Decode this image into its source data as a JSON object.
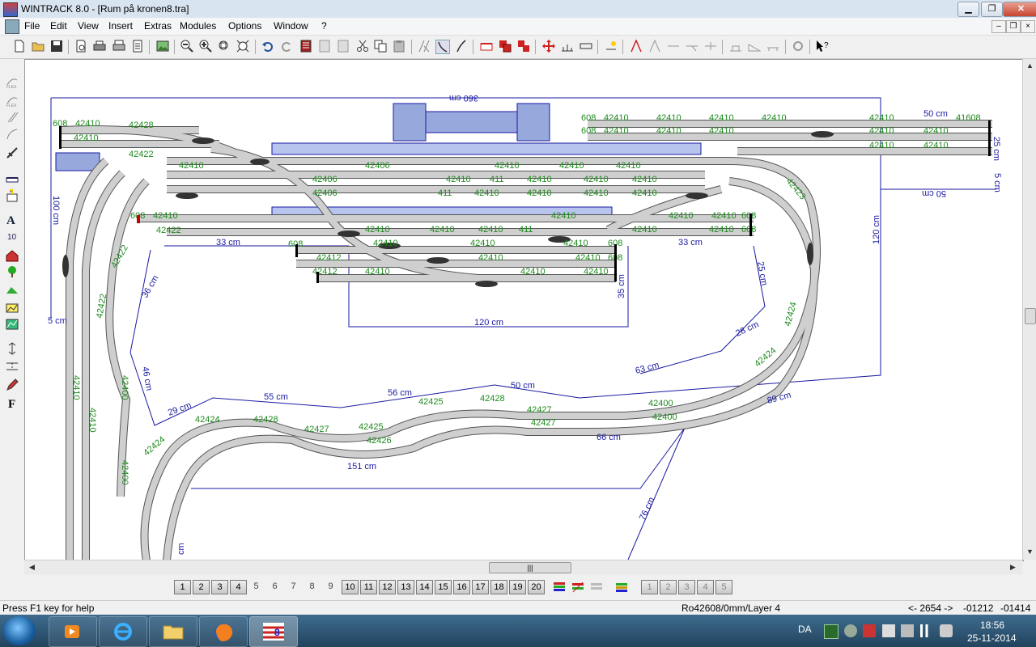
{
  "window": {
    "title": "WINTRACK 8.0 - [Rum på kronen8.tra]"
  },
  "menu": [
    "File",
    "Edit",
    "View",
    "Insert",
    "Extras",
    "Modules",
    "Options",
    "Window",
    "?"
  ],
  "layers": {
    "buttons": [
      "1",
      "2",
      "3",
      "4",
      "5",
      "6",
      "7",
      "8",
      "9",
      "10",
      "11",
      "12",
      "13",
      "14",
      "15",
      "16",
      "17",
      "18",
      "19",
      "20"
    ],
    "active": "4",
    "extra_buttons": [
      "1",
      "2",
      "3",
      "4",
      "5"
    ]
  },
  "status": {
    "help": "Press F1 key for help",
    "info": "Ro42608/0mm/Layer 4",
    "coord1": "<- 2654 ->",
    "coord2": "-01212",
    "coord3": "-01414"
  },
  "taskbar": {
    "lang": "DA",
    "time": "18:56",
    "date": "25-11-2014"
  },
  "canvas": {
    "dimensions": [
      "360 cm",
      "120 cm",
      "50 cm",
      "25 cm",
      "5 cm",
      "50 cm",
      "100 cm",
      "5 cm",
      "33 cm",
      "33 cm",
      "35 cm",
      "120 cm",
      "25 cm",
      "36 cm",
      "46 cm",
      "29 cm",
      "55 cm",
      "56 cm",
      "50 cm",
      "63 cm",
      "28 cm",
      "89 cm",
      "66 cm",
      "151 cm",
      "76 cm",
      "cm"
    ],
    "track_codes": [
      "608",
      "42410",
      "42428",
      "42422",
      "42423",
      "42406",
      "411",
      "41608",
      "42412",
      "42400",
      "42424",
      "42425",
      "42427",
      "42426"
    ]
  },
  "colors": {
    "track_label": "#1d8a1d",
    "dimension": "#1a1aa0",
    "track_fill": "#c8c8c8"
  }
}
